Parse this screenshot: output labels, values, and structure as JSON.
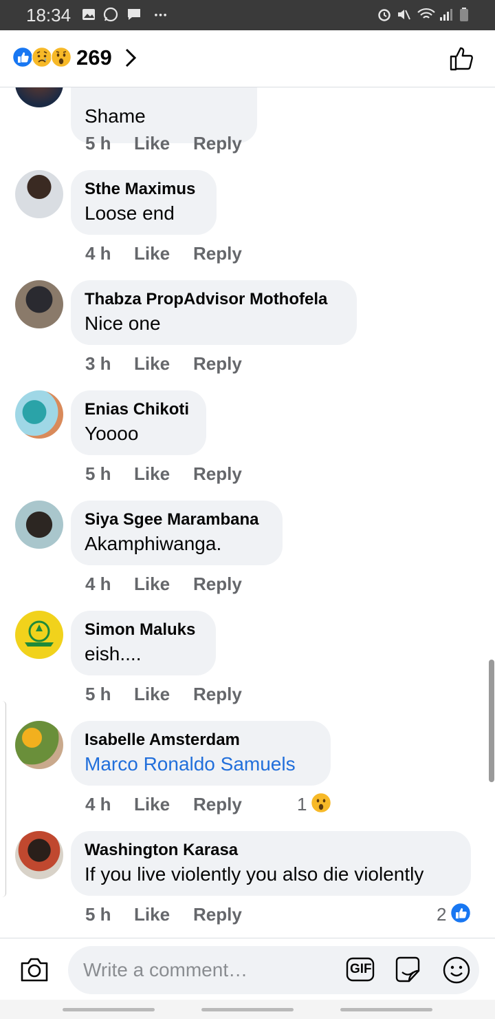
{
  "status_bar": {
    "time": "18:34"
  },
  "header": {
    "reaction_count": "269",
    "reaction_icons": [
      "like-icon",
      "sad-icon",
      "wow-icon"
    ]
  },
  "comments": [
    {
      "name": "",
      "text": "Shame",
      "time": "5 h"
    },
    {
      "name": "Sthe Maximus",
      "text": "Loose end",
      "time": "4 h"
    },
    {
      "name": "Thabza PropAdvisor Mothofela",
      "text": "Nice one",
      "time": "3 h"
    },
    {
      "name": "Enias Chikoti",
      "text": "Yoooo",
      "time": "5 h"
    },
    {
      "name": "Siya Sgee Marambana",
      "text": "Akamphiwanga.",
      "time": "4 h"
    },
    {
      "name": "Simon Maluks",
      "text": "eish....",
      "time": "5 h"
    },
    {
      "name": "Isabelle Amsterdam",
      "text": "Marco Ronaldo Samuels",
      "time": "4 h",
      "reaction_count": "1",
      "reaction_icon": "wow-icon"
    },
    {
      "name": "Washington Karasa",
      "text": "If you live violently you also die violently",
      "time": "5 h",
      "reaction_count": "2",
      "reaction_icon": "like-icon"
    }
  ],
  "actions": {
    "like": "Like",
    "reply": "Reply"
  },
  "composer": {
    "placeholder": "Write a comment…",
    "gif_label": "GIF"
  },
  "colors": {
    "link": "#216fdb",
    "like_blue": "#1877f2",
    "bubble": "#f0f2f5",
    "meta": "#65676b"
  }
}
